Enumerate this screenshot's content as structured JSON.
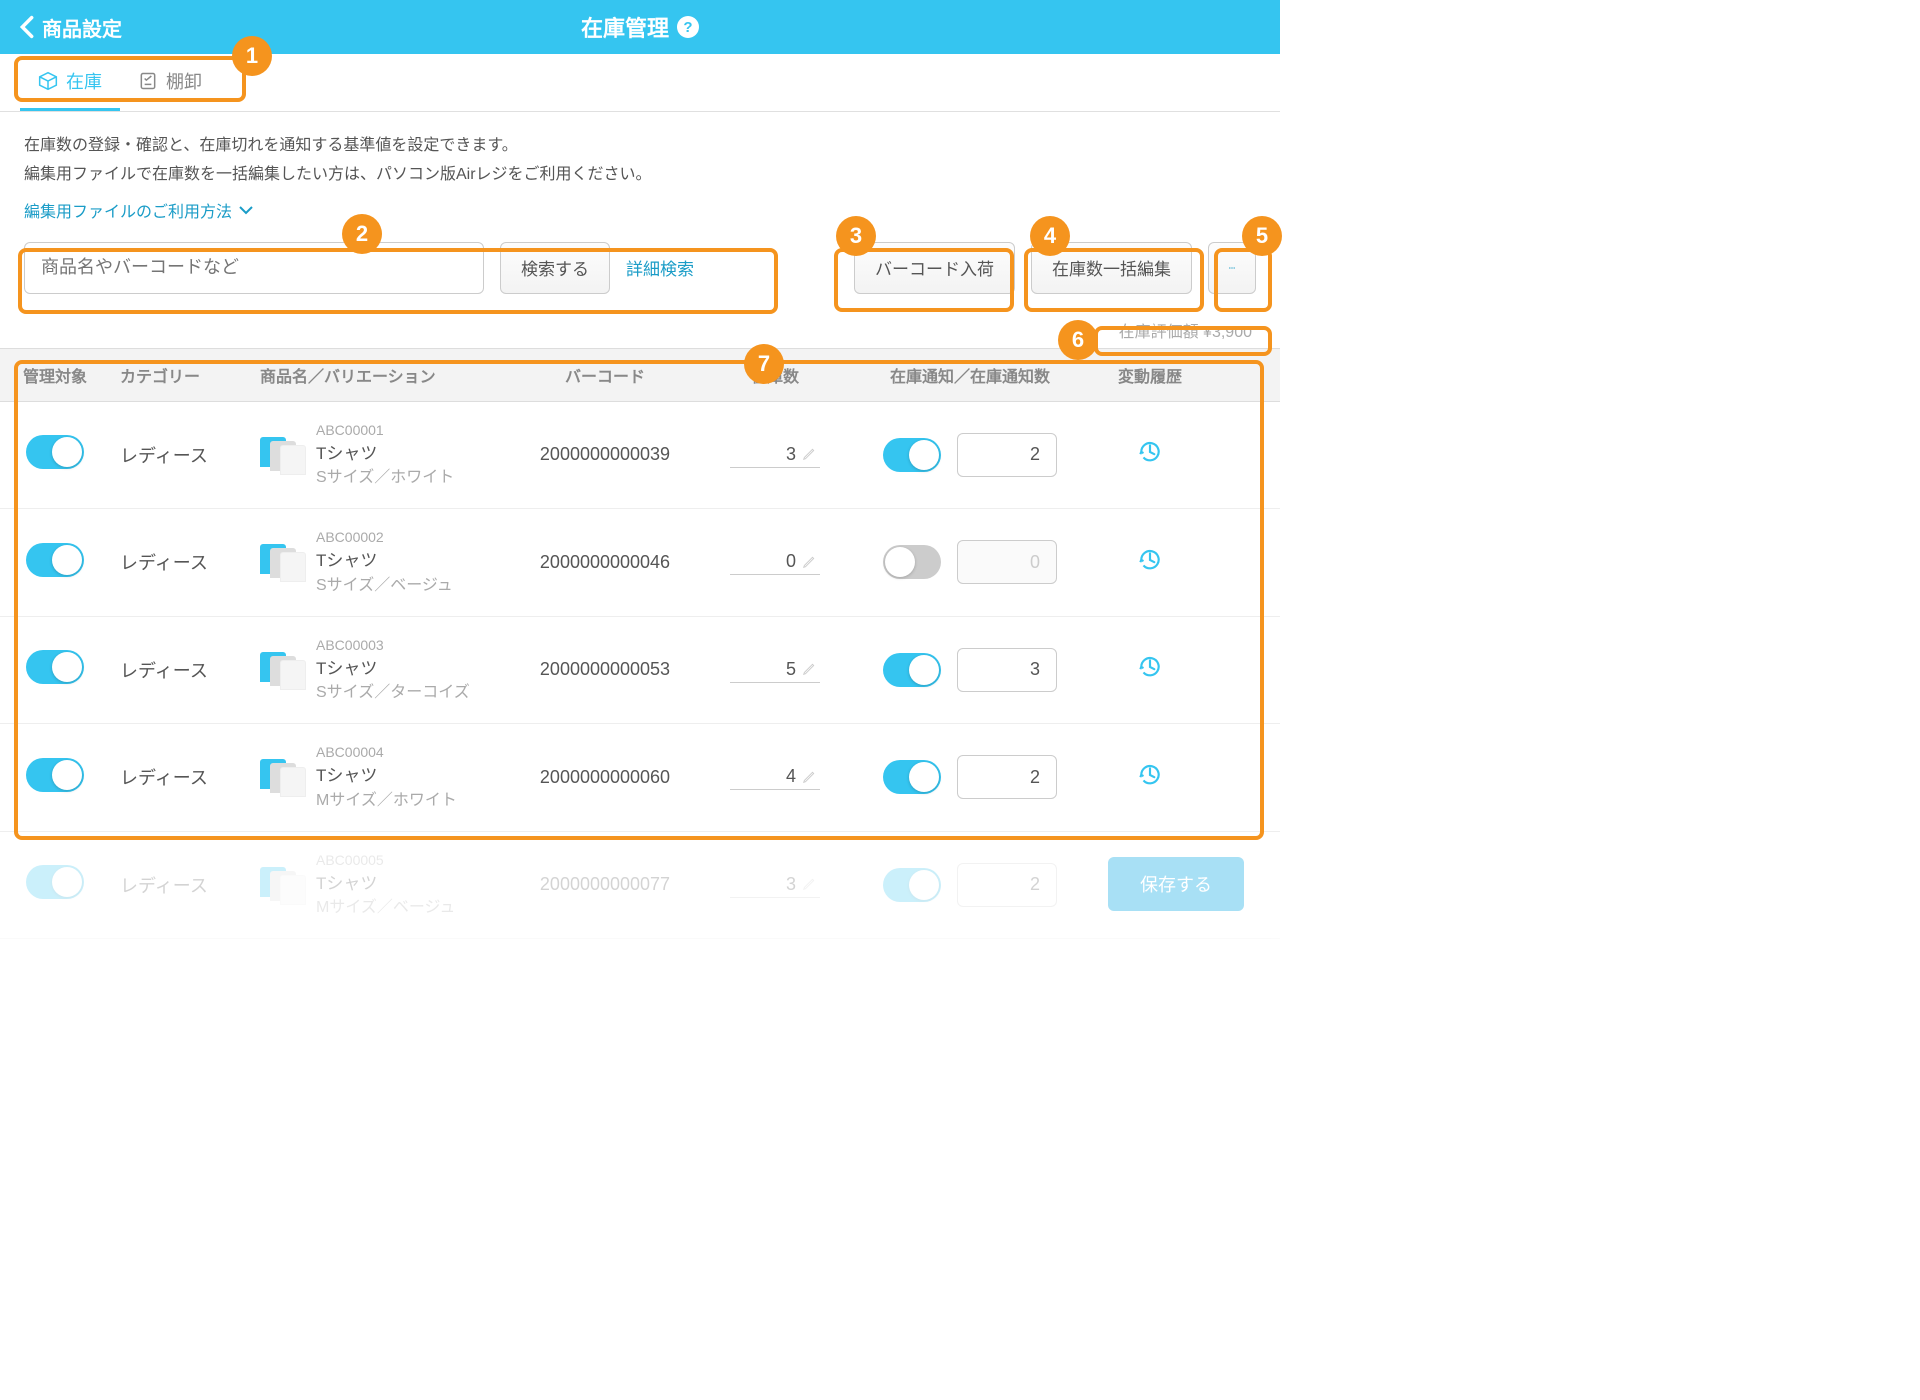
{
  "header": {
    "back": "商品設定",
    "title": "在庫管理"
  },
  "tabs": {
    "stock": "在庫",
    "inventory": "棚卸"
  },
  "desc": {
    "l1": "在庫数の登録・確認と、在庫切れを通知する基準値を設定できます。",
    "l2": "編集用ファイルで在庫数を一括編集したい方は、パソコン版Airレジをご利用ください。"
  },
  "editLink": "編集用ファイルのご利用方法",
  "search": {
    "placeholder": "商品名やバーコードなど",
    "button": "検索する",
    "advanced": "詳細検索"
  },
  "actions": {
    "barcode": "バーコード入荷",
    "bulkEdit": "在庫数一括編集"
  },
  "valuation": "在庫評価額 ¥3,900",
  "columns": {
    "manage": "管理対象",
    "category": "カテゴリー",
    "product": "商品名／バリエーション",
    "barcode": "バーコード",
    "stock": "在庫数",
    "notify": "在庫通知／在庫通知数",
    "history": "変動履歴"
  },
  "save": "保存する",
  "callouts": {
    "c1": "1",
    "c2": "2",
    "c3": "3",
    "c4": "4",
    "c5": "5",
    "c6": "6",
    "c7": "7"
  },
  "rows": [
    {
      "manage": true,
      "category": "レディース",
      "sku": "ABC00001",
      "name": "Tシャツ",
      "variant": "Sサイズ／ホワイト",
      "barcode": "2000000000039",
      "stock": "3",
      "notify": true,
      "notifyCount": "2"
    },
    {
      "manage": true,
      "category": "レディース",
      "sku": "ABC00002",
      "name": "Tシャツ",
      "variant": "Sサイズ／ベージュ",
      "barcode": "2000000000046",
      "stock": "0",
      "notify": false,
      "notifyCount": "0"
    },
    {
      "manage": true,
      "category": "レディース",
      "sku": "ABC00003",
      "name": "Tシャツ",
      "variant": "Sサイズ／ターコイズ",
      "barcode": "2000000000053",
      "stock": "5",
      "notify": true,
      "notifyCount": "3"
    },
    {
      "manage": true,
      "category": "レディース",
      "sku": "ABC00004",
      "name": "Tシャツ",
      "variant": "Mサイズ／ホワイト",
      "barcode": "2000000000060",
      "stock": "4",
      "notify": true,
      "notifyCount": "2"
    },
    {
      "manage": true,
      "category": "レディース",
      "sku": "ABC00005",
      "name": "Tシャツ",
      "variant": "Mサイズ／ベージュ",
      "barcode": "2000000000077",
      "stock": "3",
      "notify": true,
      "notifyCount": "2",
      "faded": true
    }
  ]
}
